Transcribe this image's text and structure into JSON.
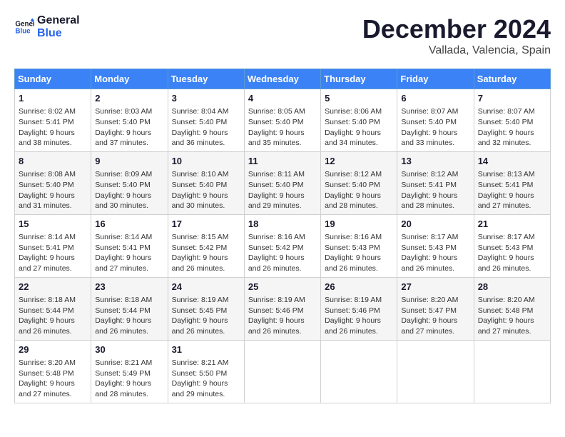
{
  "header": {
    "logo_line1": "General",
    "logo_line2": "Blue",
    "title": "December 2024",
    "subtitle": "Vallada, Valencia, Spain"
  },
  "days_of_week": [
    "Sunday",
    "Monday",
    "Tuesday",
    "Wednesday",
    "Thursday",
    "Friday",
    "Saturday"
  ],
  "weeks": [
    [
      {
        "day": "1",
        "sunrise": "8:02 AM",
        "sunset": "5:41 PM",
        "daylight": "9 hours and 38 minutes."
      },
      {
        "day": "2",
        "sunrise": "8:03 AM",
        "sunset": "5:40 PM",
        "daylight": "9 hours and 37 minutes."
      },
      {
        "day": "3",
        "sunrise": "8:04 AM",
        "sunset": "5:40 PM",
        "daylight": "9 hours and 36 minutes."
      },
      {
        "day": "4",
        "sunrise": "8:05 AM",
        "sunset": "5:40 PM",
        "daylight": "9 hours and 35 minutes."
      },
      {
        "day": "5",
        "sunrise": "8:06 AM",
        "sunset": "5:40 PM",
        "daylight": "9 hours and 34 minutes."
      },
      {
        "day": "6",
        "sunrise": "8:07 AM",
        "sunset": "5:40 PM",
        "daylight": "9 hours and 33 minutes."
      },
      {
        "day": "7",
        "sunrise": "8:07 AM",
        "sunset": "5:40 PM",
        "daylight": "9 hours and 32 minutes."
      }
    ],
    [
      {
        "day": "8",
        "sunrise": "8:08 AM",
        "sunset": "5:40 PM",
        "daylight": "9 hours and 31 minutes."
      },
      {
        "day": "9",
        "sunrise": "8:09 AM",
        "sunset": "5:40 PM",
        "daylight": "9 hours and 30 minutes."
      },
      {
        "day": "10",
        "sunrise": "8:10 AM",
        "sunset": "5:40 PM",
        "daylight": "9 hours and 30 minutes."
      },
      {
        "day": "11",
        "sunrise": "8:11 AM",
        "sunset": "5:40 PM",
        "daylight": "9 hours and 29 minutes."
      },
      {
        "day": "12",
        "sunrise": "8:12 AM",
        "sunset": "5:40 PM",
        "daylight": "9 hours and 28 minutes."
      },
      {
        "day": "13",
        "sunrise": "8:12 AM",
        "sunset": "5:41 PM",
        "daylight": "9 hours and 28 minutes."
      },
      {
        "day": "14",
        "sunrise": "8:13 AM",
        "sunset": "5:41 PM",
        "daylight": "9 hours and 27 minutes."
      }
    ],
    [
      {
        "day": "15",
        "sunrise": "8:14 AM",
        "sunset": "5:41 PM",
        "daylight": "9 hours and 27 minutes."
      },
      {
        "day": "16",
        "sunrise": "8:14 AM",
        "sunset": "5:41 PM",
        "daylight": "9 hours and 27 minutes."
      },
      {
        "day": "17",
        "sunrise": "8:15 AM",
        "sunset": "5:42 PM",
        "daylight": "9 hours and 26 minutes."
      },
      {
        "day": "18",
        "sunrise": "8:16 AM",
        "sunset": "5:42 PM",
        "daylight": "9 hours and 26 minutes."
      },
      {
        "day": "19",
        "sunrise": "8:16 AM",
        "sunset": "5:43 PM",
        "daylight": "9 hours and 26 minutes."
      },
      {
        "day": "20",
        "sunrise": "8:17 AM",
        "sunset": "5:43 PM",
        "daylight": "9 hours and 26 minutes."
      },
      {
        "day": "21",
        "sunrise": "8:17 AM",
        "sunset": "5:43 PM",
        "daylight": "9 hours and 26 minutes."
      }
    ],
    [
      {
        "day": "22",
        "sunrise": "8:18 AM",
        "sunset": "5:44 PM",
        "daylight": "9 hours and 26 minutes."
      },
      {
        "day": "23",
        "sunrise": "8:18 AM",
        "sunset": "5:44 PM",
        "daylight": "9 hours and 26 minutes."
      },
      {
        "day": "24",
        "sunrise": "8:19 AM",
        "sunset": "5:45 PM",
        "daylight": "9 hours and 26 minutes."
      },
      {
        "day": "25",
        "sunrise": "8:19 AM",
        "sunset": "5:46 PM",
        "daylight": "9 hours and 26 minutes."
      },
      {
        "day": "26",
        "sunrise": "8:19 AM",
        "sunset": "5:46 PM",
        "daylight": "9 hours and 26 minutes."
      },
      {
        "day": "27",
        "sunrise": "8:20 AM",
        "sunset": "5:47 PM",
        "daylight": "9 hours and 27 minutes."
      },
      {
        "day": "28",
        "sunrise": "8:20 AM",
        "sunset": "5:48 PM",
        "daylight": "9 hours and 27 minutes."
      }
    ],
    [
      {
        "day": "29",
        "sunrise": "8:20 AM",
        "sunset": "5:48 PM",
        "daylight": "9 hours and 27 minutes."
      },
      {
        "day": "30",
        "sunrise": "8:21 AM",
        "sunset": "5:49 PM",
        "daylight": "9 hours and 28 minutes."
      },
      {
        "day": "31",
        "sunrise": "8:21 AM",
        "sunset": "5:50 PM",
        "daylight": "9 hours and 29 minutes."
      },
      null,
      null,
      null,
      null
    ]
  ],
  "labels": {
    "sunrise": "Sunrise: ",
    "sunset": "Sunset: ",
    "daylight": "Daylight: "
  }
}
